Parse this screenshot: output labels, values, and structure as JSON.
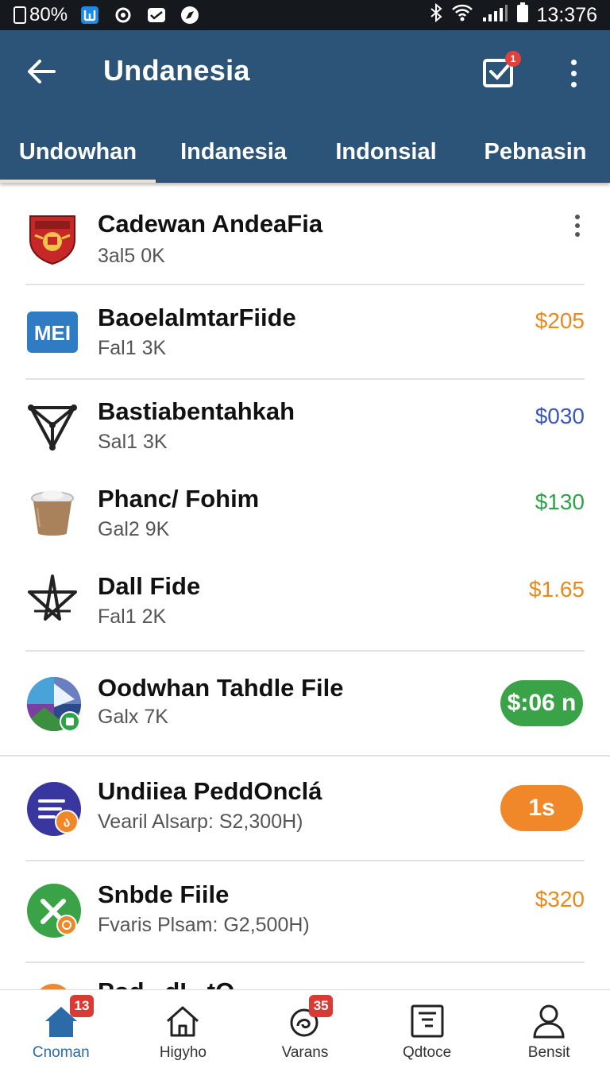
{
  "status_bar": {
    "battery_text": "80%",
    "time": "13:376"
  },
  "app_bar": {
    "title": "Undanesia",
    "inbox_badge": "1"
  },
  "tabs": [
    {
      "label": "Undowhan",
      "active": true
    },
    {
      "label": "Indanesia",
      "active": false
    },
    {
      "label": "Indonsial",
      "active": false
    },
    {
      "label": "Pebnasin",
      "active": false
    }
  ],
  "list": [
    {
      "title": "Cadewan AndeaFia",
      "subtitle": "3al5 0K",
      "price": "",
      "icon": "crest-badge-icon"
    },
    {
      "title": "BaoelalmtarFiide",
      "subtitle": "Fal1 3K",
      "price": "$205",
      "price_color": "#e8891d",
      "icon": "mei-logo-icon",
      "icon_text": "MEI"
    },
    {
      "title": "Bastiabentahkah",
      "subtitle": "Sal1 3K",
      "price": "$030",
      "price_color": "#3a56b8",
      "icon": "triangle-network-icon"
    },
    {
      "title": "Phanc/ Fohim",
      "subtitle": "Gal2 9K",
      "price": "$130",
      "price_color": "#2fa148",
      "icon": "coffee-cup-icon"
    },
    {
      "title": "Dall Fide",
      "subtitle": "Fal1 2K",
      "price": "$1.65",
      "price_color": "#e8891d",
      "icon": "star-knot-icon"
    },
    {
      "title": "Oodwhan Tahdle File",
      "subtitle": "Galx 7K",
      "price": "$:06 n",
      "price_color": "#3aa348",
      "icon": "photo-collage-icon",
      "pill": true
    },
    {
      "title": "Undiiea PeddOnclá",
      "subtitle": "Vearil Alsarp: S2,300H)",
      "price": "1s",
      "price_color": "#f0882a",
      "icon": "list-app-icon",
      "pill": true
    },
    {
      "title": "Snbde Fiile",
      "subtitle": "Fvaris Plsam: G2,500H)",
      "price": "$320",
      "price_color": "#e8891d",
      "icon": "x-app-icon"
    }
  ],
  "partial_row": {
    "title": "Pod...dI...tO..."
  },
  "bottom_nav": [
    {
      "label": "Cnoman",
      "icon": "home-icon",
      "badge": "13",
      "active": true
    },
    {
      "label": "Higyho",
      "icon": "house-outline-icon",
      "badge": "",
      "active": false
    },
    {
      "label": "Varans",
      "icon": "swirl-icon",
      "badge": "35",
      "active": false
    },
    {
      "label": "Qdtoce",
      "icon": "document-icon",
      "badge": "",
      "active": false
    },
    {
      "label": "Bensit",
      "icon": "person-icon",
      "badge": "",
      "active": false
    }
  ]
}
